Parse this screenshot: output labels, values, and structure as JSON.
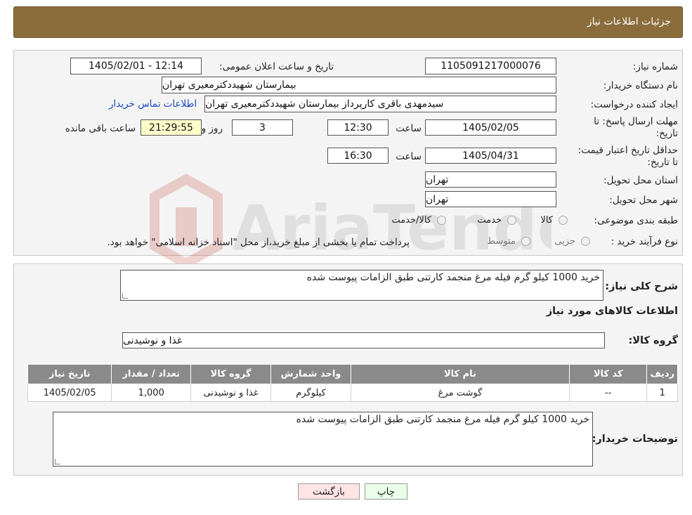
{
  "header": {
    "title": "جزئیات اطلاعات نیاز"
  },
  "fields": {
    "need_number_label": "شماره نیاز:",
    "need_number": "1105091217000076",
    "announce_label": "تاریخ و ساعت اعلان عمومی:",
    "announce_value": "1405/02/01 - 12:14",
    "buyer_org_label": "نام دستگاه خریدار:",
    "buyer_org": "بیمارستان شهیددکترمعیری تهران",
    "creator_label": "ایجاد کننده درخواست:",
    "creator": "سیدمهدی باقری کارپرداز بیمارستان شهیددکترمعیری تهران",
    "contact_link": "اطلاعات تماس خریدار",
    "deadline_label": "مهلت ارسال پاسخ: تا تاریخ:",
    "deadline_date": "1405/02/05",
    "time_label": "ساعت",
    "deadline_time": "12:30",
    "days_value": "3",
    "days_label": "روز و",
    "remaining_time": "21:29:55",
    "remaining_label": "ساعت باقی مانده",
    "validity_label": "حداقل تاریخ اعتبار قیمت: تا تاریخ:",
    "validity_date": "1405/04/31",
    "validity_time": "16:30",
    "province_label": "استان محل تحویل:",
    "province": "تهران",
    "city_label": "شهر محل تحویل:",
    "city": "تهران",
    "category_label": "طبقه بندی موضوعی:",
    "category_options": [
      "کالا",
      "خدمت",
      "کالا/خدمت"
    ],
    "process_label": "نوع فرآیند خرید :",
    "process_options": [
      "جزیی",
      "متوسط"
    ],
    "process_note": "پرداخت تمام یا بخشی از مبلغ خرید،از محل \"اسناد خزانه اسلامی\" خواهد بود."
  },
  "details": {
    "description_label": "شرح کلی نیاز:",
    "description": "خرید 1000 کیلو گرم فیله مرغ منجمد کارتنی طبق الزامات پیوست شده",
    "goods_info_title": "اطلاعات کالاهای مورد نیاز",
    "goods_group_label": "گروه کالا:",
    "goods_group": "غذا و نوشیدنی",
    "table": {
      "headers": [
        "ردیف",
        "کد کالا",
        "نام کالا",
        "واحد شمارش",
        "گروه کالا",
        "تعداد / مقدار",
        "تاریخ نیاز"
      ],
      "rows": [
        [
          "1",
          "--",
          "گوشت مرغ",
          "کیلوگرم",
          "غذا و نوشیدنی",
          "1,000",
          "1405/02/05"
        ]
      ]
    },
    "buyer_notes_label": "توضیحات خریدار:",
    "buyer_notes": "خرید 1000 کیلو گرم فیله مرغ منجمد کارتنی طبق الزامات پیوست شده"
  },
  "buttons": {
    "print": "چاپ",
    "back": "بازگشت"
  },
  "watermark": {
    "text": "AriaTender.neT"
  },
  "colors": {
    "header": "#8a6d3b",
    "table_header": "#8a8a8a",
    "remaining_bg": "#ffffcc",
    "print_bg": "#eaffea",
    "back_bg": "#ffe4e4",
    "link": "#1b47c4"
  }
}
